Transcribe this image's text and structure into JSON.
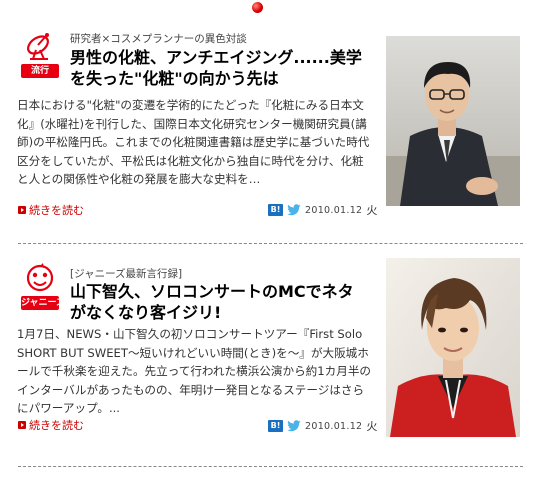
{
  "articles": [
    {
      "category_icon": "satellite-dish-icon",
      "category_badge": "流行",
      "kicker": "研究者×コスメプランナーの異色対談",
      "headline": "男性の化粧、アンチエイジング......美学を失った\"化粧\"の向かう先は",
      "summary": "日本における\"化粧\"の変遷を学術的にたどった『化粧にみる日本文化』(水曜社)を刊行した、国際日本文化研究センター機関研究員(講師)の平松隆円氏。これまでの化粧関連書籍は歴史学に基づいた時代区分をしていたが、平松氏は化粧文化から独自に時代を分け、化粧と人との関係性や化粧の発展を膨大な史料を…",
      "read_more": "続きを読む",
      "bookmark_label": "B!",
      "date": "2010.01.12",
      "day": "火",
      "photo": "man-in-suit-glasses"
    },
    {
      "category_icon": "johnnys-mascot-icon",
      "category_badge": "ジャニーズ",
      "kicker": "[ジャニーズ最新言行録]",
      "headline": "山下智久、ソロコンサートのMCでネタがなくなり客イジリ!",
      "summary": "1月7日、NEWS・山下智久の初ソロコンサートツアー『First Solo SHORT BUT SWEET～短いけれどいい時間(とき)を～』が大阪城ホールで千秋楽を迎えた。先立って行われた横浜公演から約1カ月半のインターバルがあったものの、年明け一発目となるステージはさらにパワーアップ。...",
      "read_more": "続きを読む",
      "bookmark_label": "B!",
      "date": "2010.01.12",
      "day": "火",
      "photo": "young-man-red-jacket"
    }
  ],
  "colors": {
    "accent": "#e60012",
    "link": "#cc0000",
    "hatena": "#1a6fbf",
    "twitter": "#4ab3e8"
  }
}
